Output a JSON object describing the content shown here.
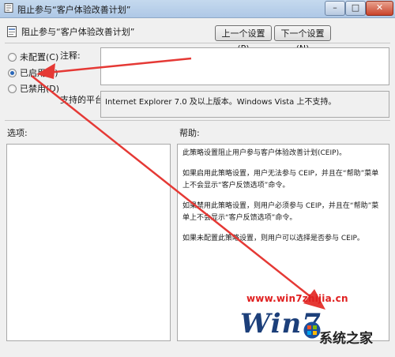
{
  "window": {
    "title": "阻止参与“客户体验改善计划”",
    "controls": {
      "minimize": "–",
      "maximize": "□",
      "close": "✕"
    }
  },
  "header": {
    "title": "阻止参与“客户体验改善计划”",
    "prev_button": "上一个设置(P)",
    "next_button": "下一个设置(N)"
  },
  "state": {
    "options": [
      {
        "label": "未配置(C)",
        "checked": false
      },
      {
        "label": "已启用(E)",
        "checked": true
      },
      {
        "label": "已禁用(D)",
        "checked": false
      }
    ]
  },
  "comment": {
    "label": "注释:",
    "value": ""
  },
  "platform": {
    "label": "支持的平台:",
    "value": "Internet Explorer 7.0 及以上版本。Windows Vista 上不支持。"
  },
  "options_panel": {
    "label": "选项:"
  },
  "help_panel": {
    "label": "帮助:",
    "paragraphs": [
      "此策略设置阻止用户参与客户体验改善计划(CEIP)。",
      "如果启用此策略设置，用户无法参与 CEIP，并且在“帮助”菜单上不会显示“客户反馈选项”命令。",
      "如果禁用此策略设置，则用户必须参与 CEIP，并且在“帮助”菜单上不会显示“客户反馈选项”命令。",
      "如果未配置此策略设置，则用户可以选择是否参与 CEIP。"
    ]
  },
  "watermark": {
    "url": "www.win7zhijia.cn",
    "win_text": "Win7",
    "brand": "系统之家"
  },
  "colors": {
    "arrow": "#e53935",
    "selected_radio": "#2a67b8"
  }
}
